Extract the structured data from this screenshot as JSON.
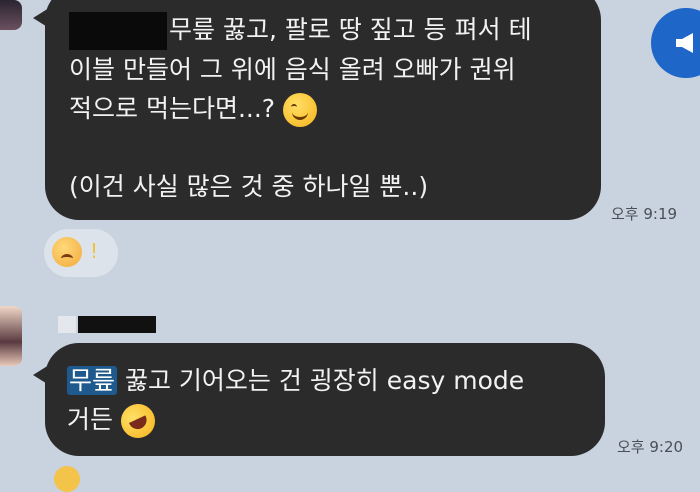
{
  "messages": [
    {
      "lines": [
        "무릎 꿇고, 팔로 땅 짚고 등 펴서 테",
        "이블 만들어 그 위에 음식 올려 오빠가 권위",
        "적으로 먹는다면...?",
        "(이건 사실 많은 것 중 하나일 뿐..)"
      ],
      "emoji": "smiling-face-emoji",
      "time": "오후 9:19"
    },
    {
      "highlighted": "무릎",
      "line1_rest": " 꿇고 기어오는 건 굉장히 easy mode",
      "line2": "거든",
      "emoji": "rolling-on-floor-laughing-emoji",
      "time": "오후 9:20"
    }
  ],
  "reaction": {
    "emoji": "crying-face-emoji",
    "mark": "!"
  },
  "colors": {
    "background": "#c9d3df",
    "bubble": "#2b2b2c",
    "highlight": "#1f5a8e",
    "accent": "#1e66c8"
  },
  "icons": {
    "speaker": "megaphone-icon"
  }
}
